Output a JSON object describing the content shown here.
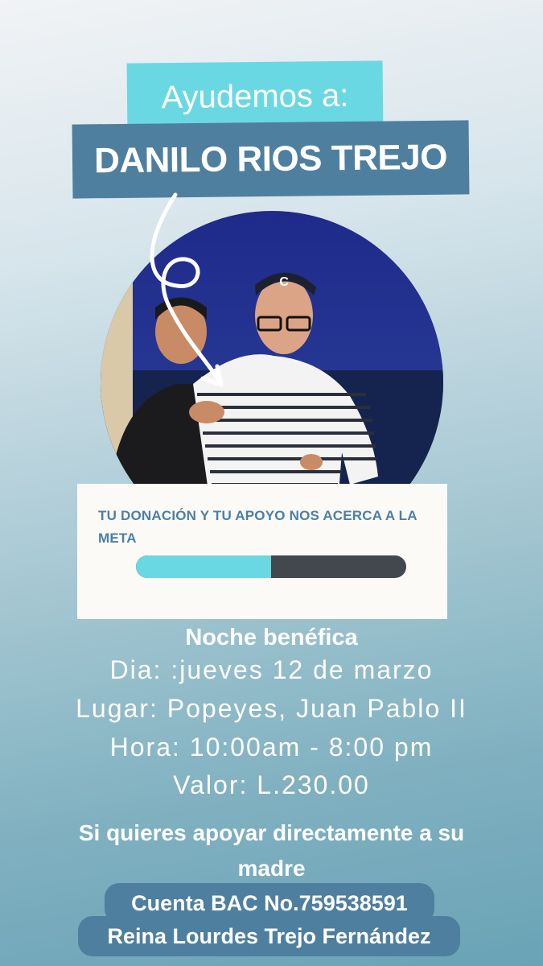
{
  "header": {
    "help_label": "Ayudemos a:",
    "person_name": "DANILO RIOS TREJO"
  },
  "card": {
    "message": "TU DONACIÓN Y TU APOYO NOS ACERCA A LA META",
    "progress_fraction": 0.5
  },
  "event": {
    "title": "Noche benéfica",
    "day": "Dia: :jueves 12 de marzo",
    "place": "Lugar: Popeyes, Juan Pablo II",
    "time": "Hora: 10:00am - 8:00 pm",
    "price": "Valor: L.230.00"
  },
  "support": {
    "text": "Si quieres apoyar directamente a su madre",
    "account": "Cuenta BAC No.759538591",
    "holder": "Reina Lourdes Trejo Fernández"
  },
  "colors": {
    "accent_cyan": "#6ad8e3",
    "banner_blue": "#4f7f9f",
    "progress_track": "#43484f"
  }
}
